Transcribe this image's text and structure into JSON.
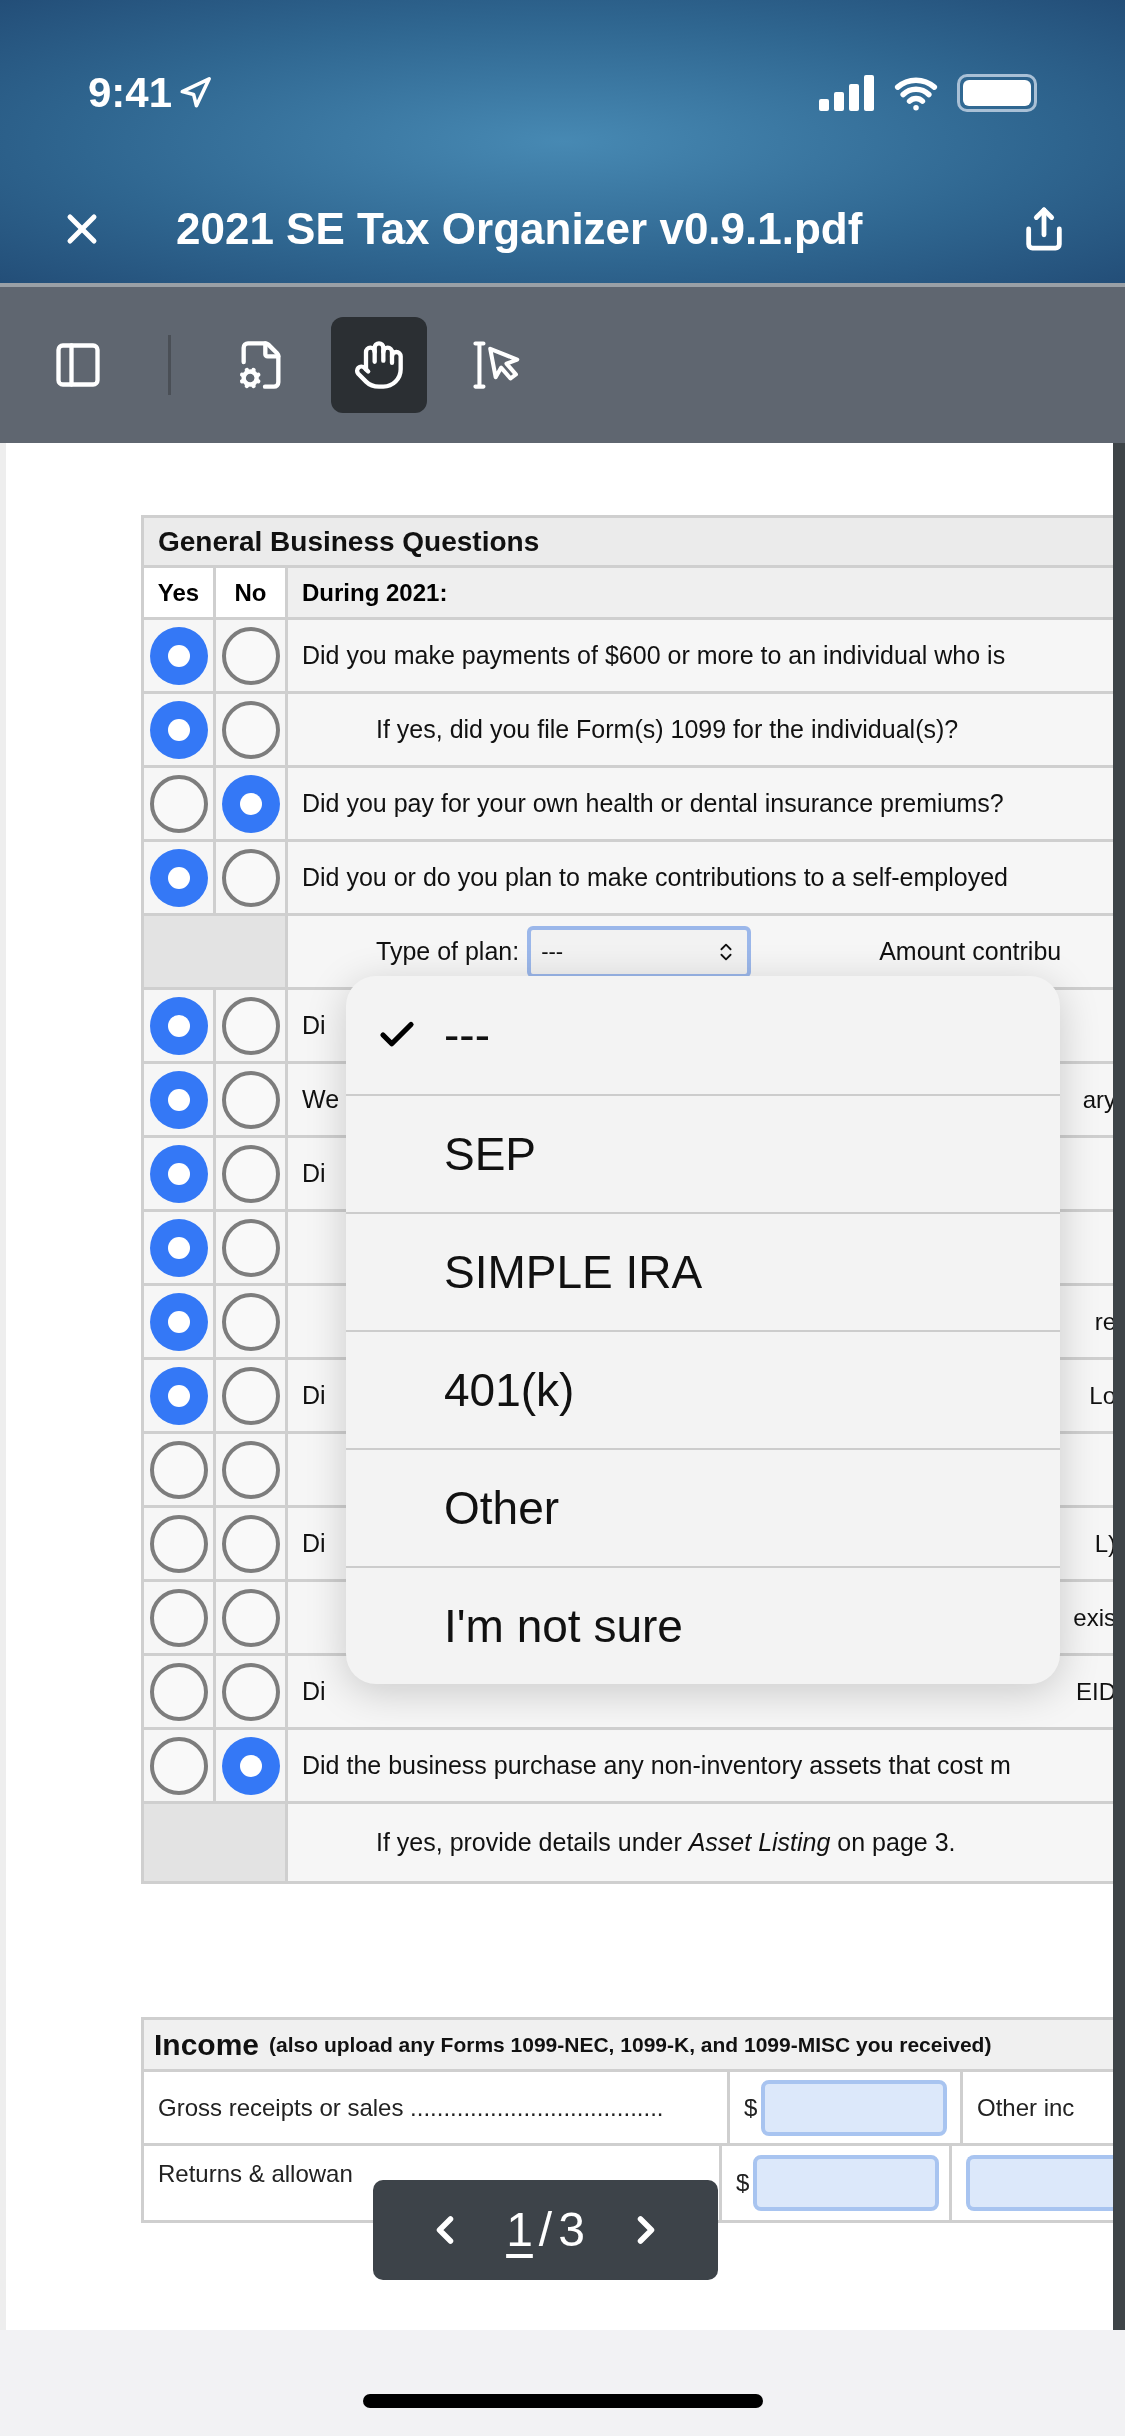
{
  "status_bar": {
    "time": "9:41"
  },
  "header": {
    "title": "2021 SE Tax Organizer v0.9.1.pdf"
  },
  "toolbar": [
    {
      "kind": "sidebar",
      "selected": false
    },
    {
      "kind": "page-settings",
      "selected": false
    },
    {
      "kind": "hand",
      "selected": true
    },
    {
      "kind": "text-select",
      "selected": false
    }
  ],
  "questions": {
    "title": "General Business Questions",
    "yes_heading": "Yes",
    "no_heading": "No",
    "period_heading": "During 2021:",
    "rows": [
      {
        "kind": "question",
        "text": "Did you make payments of $600 or more to an individual who is",
        "yes": true,
        "no": false
      },
      {
        "kind": "subquestion",
        "text": "If yes, did you file Form(s) 1099 for the individual(s)?",
        "yes": true,
        "no": false
      },
      {
        "kind": "question",
        "text": "Did you pay for your own health or dental insurance premiums?",
        "yes": false,
        "no": true
      },
      {
        "kind": "question",
        "text": "Did you or do you plan to make contributions to a self-employed",
        "yes": true,
        "no": false
      },
      {
        "kind": "plan",
        "label": "Type of plan:",
        "value": "---",
        "amount_label": "Amount contribu"
      },
      {
        "kind": "covered",
        "left": "Di",
        "yes": true,
        "no": false
      },
      {
        "kind": "covered",
        "left": "We",
        "right": "ary",
        "yes": true,
        "no": false
      },
      {
        "kind": "covered",
        "left": "Di",
        "yes": true,
        "no": false
      },
      {
        "kind": "covered",
        "yes": true,
        "no": false
      },
      {
        "kind": "covered",
        "right": "re",
        "yes": true,
        "no": false
      },
      {
        "kind": "covered",
        "left": "Di",
        "right": "Lo",
        "yes": true,
        "no": false
      },
      {
        "kind": "covered",
        "yes": false,
        "no": false
      },
      {
        "kind": "covered",
        "left": "Di",
        "right": "L)",
        "yes": false,
        "no": false
      },
      {
        "kind": "covered",
        "right": "exis",
        "yes": false,
        "no": false
      },
      {
        "kind": "covered",
        "left": "Di",
        "right": "EID",
        "yes": false,
        "no": false
      },
      {
        "kind": "question",
        "text": "Did the business purchase any non-inventory assets that cost m",
        "yes": false,
        "no": true
      },
      {
        "kind": "note",
        "text": "If yes, provide details under *Asset Listing* on page 3."
      }
    ]
  },
  "plan_menu": [
    {
      "label": "---",
      "selected": true
    },
    {
      "label": "SEP",
      "selected": false
    },
    {
      "label": "SIMPLE IRA",
      "selected": false
    },
    {
      "label": "401(k)",
      "selected": false
    },
    {
      "label": "Other",
      "selected": false
    },
    {
      "label": "I'm not sure",
      "selected": false
    }
  ],
  "income": {
    "title": "Income",
    "subtitle": "(also upload any Forms 1099-NEC, 1099-K, and 1099-MISC you received)",
    "rows": [
      {
        "label": "Gross receipts or sales ......................................",
        "currency": "$",
        "other": {
          "kind": "text",
          "text": "Other inc"
        }
      },
      {
        "label": "Returns & allowan",
        "currency": "$",
        "other": {
          "kind": "field"
        }
      }
    ]
  },
  "page_nav": {
    "current": "1",
    "separator": "/",
    "total": "3"
  }
}
